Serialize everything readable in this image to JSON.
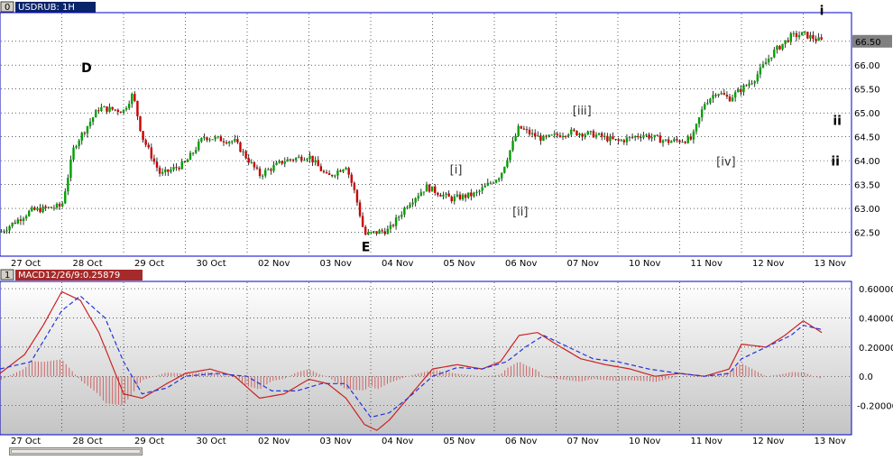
{
  "price_panel": {
    "title": "USDRUB: 1H",
    "icon_label": "0",
    "current_price_label": "66.50",
    "last_price": 66.5
  },
  "macd_panel": {
    "title": "MACD12/26/9:0.25879",
    "icon_label": "1"
  },
  "colors": {
    "frame": "#0000cc",
    "title_price_bg": "#0a246a",
    "title_macd_bg": "#a52a2a",
    "bull_candle": "#00a000",
    "bear_candle": "#cc0000",
    "macd_line": "#cc2222",
    "signal_line": "#2233dd",
    "histogram": "#cc6666",
    "macd_fill_top": "#ffffff",
    "macd_fill_bottom": "#c8c8c8"
  },
  "chart_data": [
    {
      "type": "candlestick",
      "title": "USDRUB: 1H",
      "x_labels": [
        "27 Oct",
        "28 Oct",
        "29 Oct",
        "30 Oct",
        "02 Nov",
        "03 Nov",
        "04 Nov",
        "05 Nov",
        "06 Nov",
        "07 Nov",
        "10 Nov",
        "11 Nov",
        "12 Nov",
        "13 Nov"
      ],
      "y_ticks": [
        "62.50",
        "63.00",
        "63.50",
        "64.00",
        "64.50",
        "65.00",
        "65.50",
        "66.00",
        "66.50"
      ],
      "ylim": [
        62.0,
        67.1
      ],
      "price_path_x": [
        0,
        0.5,
        1.0,
        1.2,
        1.6,
        2.0,
        2.15,
        2.3,
        2.6,
        3.0,
        3.3,
        3.8,
        4.2,
        4.6,
        5.0,
        5.3,
        5.6,
        5.75,
        5.9,
        6.3,
        6.6,
        6.9,
        7.3,
        7.7,
        8.1,
        8.4,
        8.6,
        8.8,
        9.2,
        9.6,
        10.0,
        10.4,
        10.8,
        11.2,
        11.4,
        11.6,
        11.8,
        12.2,
        12.5,
        12.8,
        13.0,
        13.3
      ],
      "price_path_y": [
        62.5,
        62.95,
        63.05,
        64.3,
        65.1,
        65.05,
        65.4,
        64.5,
        63.7,
        63.95,
        64.5,
        64.4,
        63.7,
        64.0,
        64.1,
        63.65,
        63.9,
        63.3,
        62.45,
        62.55,
        63.1,
        63.45,
        63.2,
        63.3,
        63.7,
        64.7,
        64.55,
        64.45,
        64.6,
        64.55,
        64.4,
        64.55,
        64.4,
        64.45,
        65.2,
        65.45,
        65.3,
        65.7,
        66.25,
        66.6,
        66.65,
        66.5
      ],
      "annotations": [
        {
          "text": "D",
          "x": 1.4,
          "y": 65.85,
          "style": "bold"
        },
        {
          "text": "E",
          "x": 5.92,
          "y": 62.1,
          "style": "bold"
        },
        {
          "text": "[i]",
          "x": 7.38,
          "y": 63.73,
          "style": "normal"
        },
        {
          "text": "[ii]",
          "x": 8.42,
          "y": 62.85,
          "style": "normal"
        },
        {
          "text": "[iii]",
          "x": 9.42,
          "y": 64.97,
          "style": "normal"
        },
        {
          "text": "[iv]",
          "x": 11.75,
          "y": 63.9,
          "style": "normal"
        },
        {
          "text": "i",
          "x": 13.3,
          "y": 67.05,
          "style": "bold"
        },
        {
          "text": "ii",
          "x": 13.55,
          "y": 64.75,
          "style": "bold"
        },
        {
          "text": "ii",
          "x": 13.52,
          "y": 63.9,
          "style": "bold"
        }
      ]
    },
    {
      "type": "line",
      "title": "MACD12/26/9:0.25879",
      "x_labels": [
        "27 Oct",
        "28 Oct",
        "29 Oct",
        "30 Oct",
        "02 Nov",
        "03 Nov",
        "04 Nov",
        "05 Nov",
        "06 Nov",
        "07 Nov",
        "10 Nov",
        "11 Nov",
        "12 Nov",
        "13 Nov"
      ],
      "y_ticks": [
        "0.60000",
        "0.40000",
        "0.20000",
        "0.0",
        "-0.20000"
      ],
      "ylim": [
        -0.4,
        0.65
      ],
      "series": [
        {
          "name": "MACD",
          "x": [
            0,
            0.4,
            0.7,
            1.0,
            1.3,
            1.6,
            2.0,
            2.3,
            2.7,
            3.0,
            3.4,
            3.8,
            4.2,
            4.6,
            5.0,
            5.3,
            5.6,
            5.9,
            6.1,
            6.3,
            6.6,
            7.0,
            7.4,
            7.8,
            8.1,
            8.4,
            8.7,
            9.0,
            9.4,
            9.8,
            10.2,
            10.6,
            11.0,
            11.4,
            11.8,
            12.0,
            12.4,
            12.7,
            13.0,
            13.3
          ],
          "values": [
            0.02,
            0.15,
            0.35,
            0.58,
            0.52,
            0.3,
            -0.12,
            -0.15,
            -0.05,
            0.02,
            0.05,
            0.0,
            -0.15,
            -0.12,
            -0.02,
            -0.05,
            -0.15,
            -0.33,
            -0.37,
            -0.3,
            -0.15,
            0.05,
            0.08,
            0.05,
            0.1,
            0.28,
            0.3,
            0.22,
            0.12,
            0.08,
            0.05,
            0.0,
            0.02,
            0.0,
            0.05,
            0.22,
            0.2,
            0.28,
            0.38,
            0.3
          ]
        },
        {
          "name": "Signal",
          "x": [
            0,
            0.5,
            1.0,
            1.3,
            1.7,
            2.0,
            2.3,
            2.7,
            3.0,
            3.5,
            4.0,
            4.4,
            4.8,
            5.2,
            5.6,
            6.0,
            6.3,
            6.6,
            7.0,
            7.4,
            7.8,
            8.2,
            8.5,
            8.8,
            9.2,
            9.6,
            10.0,
            10.5,
            11.0,
            11.4,
            11.8,
            12.0,
            12.4,
            12.8,
            13.0,
            13.3
          ],
          "values": [
            0.05,
            0.1,
            0.45,
            0.55,
            0.4,
            0.1,
            -0.12,
            -0.08,
            0.0,
            0.02,
            0.0,
            -0.1,
            -0.1,
            -0.05,
            -0.05,
            -0.28,
            -0.25,
            -0.15,
            0.0,
            0.06,
            0.05,
            0.1,
            0.2,
            0.28,
            0.2,
            0.12,
            0.1,
            0.05,
            0.02,
            0.0,
            0.02,
            0.12,
            0.2,
            0.28,
            0.35,
            0.32
          ]
        }
      ]
    }
  ]
}
